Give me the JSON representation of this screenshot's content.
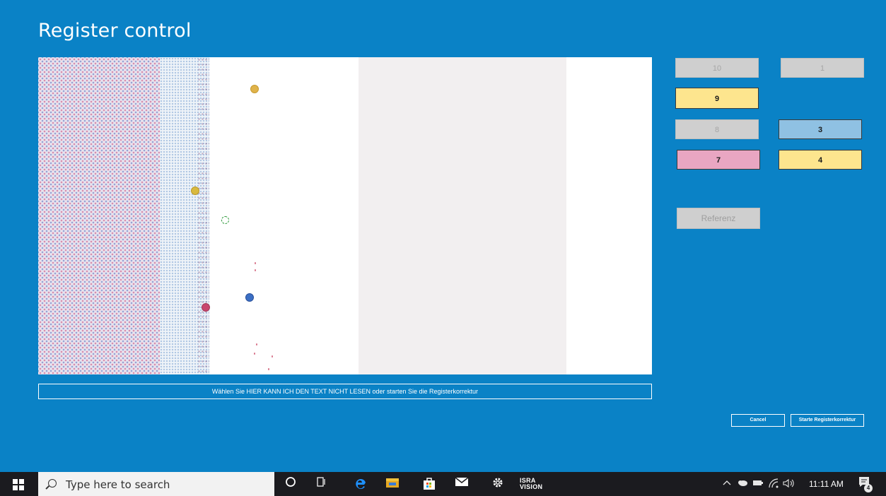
{
  "window": {
    "title": "Register control"
  },
  "status": {
    "message": "Wählen Sie HIER KANN ICH DEN TEXT NICHT LESEN  oder starten Sie die Registerkorrektur"
  },
  "register_buttons": [
    {
      "label": "10",
      "state": "disabled",
      "color": "#cfcfcf"
    },
    {
      "label": "1",
      "state": "disabled",
      "color": "#cfcfcf"
    },
    {
      "label": "9",
      "state": "active",
      "color": "#fde58e"
    },
    {
      "label": "8",
      "state": "disabled",
      "color": "#cfcfcf"
    },
    {
      "label": "3",
      "state": "active",
      "color": "#8fc1e3"
    },
    {
      "label": "7",
      "state": "active",
      "color": "#e9a6c2"
    },
    {
      "label": "4",
      "state": "active",
      "color": "#fde58e"
    }
  ],
  "reference_button": {
    "label": "Referenz",
    "state": "disabled"
  },
  "actions": {
    "cancel_label": "Cancel",
    "start_label": "Starte Registerkorrektur"
  },
  "taskbar": {
    "search_placeholder": "Type here to search",
    "time": "11:11 AM",
    "notification_count": "4",
    "app_icons": [
      "cortana-icon",
      "task-view-icon",
      "edge-icon",
      "file-explorer-icon",
      "store-icon",
      "mail-icon",
      "settings-icon",
      "isra-vision-icon"
    ],
    "isra_label_line1": "ISRA",
    "isra_label_line2": "VISION"
  },
  "colors": {
    "background": "#0a82c6",
    "taskbar": "#1b1b1f"
  }
}
